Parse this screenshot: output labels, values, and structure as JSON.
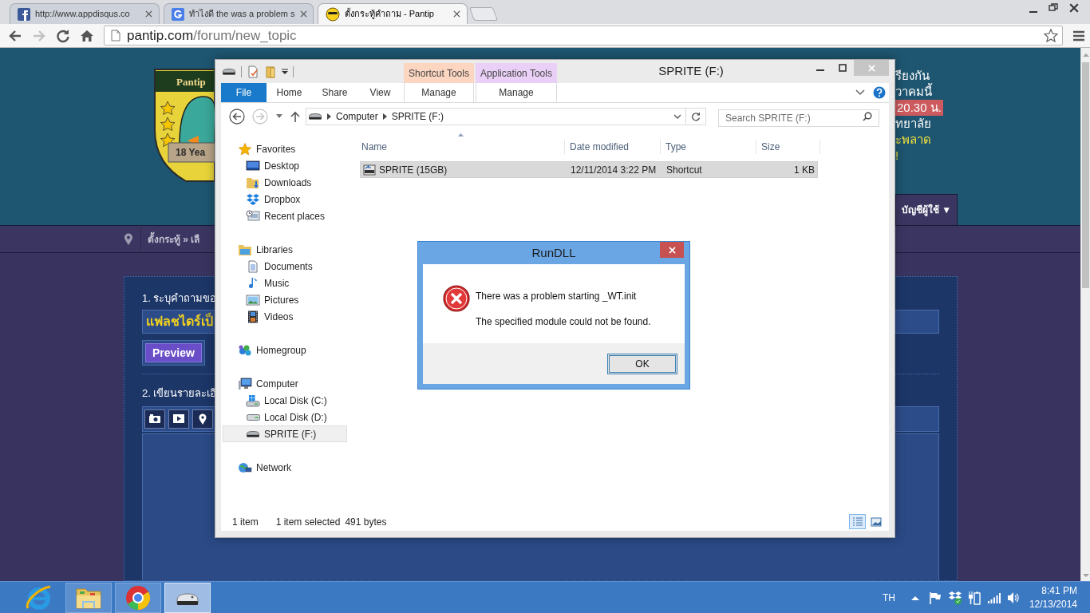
{
  "browser": {
    "tabs": [
      {
        "kind": "facebook",
        "title": "http://www.appdisqus.co",
        "selected": false
      },
      {
        "kind": "google",
        "title": "ทำไงดี the was a problem s",
        "selected": false
      },
      {
        "kind": "pantip",
        "title": "ตั้งกระทู้คำถาม - Pantip",
        "selected": true
      }
    ],
    "address": {
      "host": "pantip.com",
      "path": "/forum/new_topic"
    }
  },
  "page": {
    "logo": {
      "title": "Pantip",
      "ribbon": "18 Yea"
    },
    "announcement": [
      {
        "kind": "text",
        "text": "รียงกัน"
      },
      {
        "kind": "text",
        "text": "วาคมนี้"
      },
      {
        "kind": "tag",
        "text": "20.30 น."
      },
      {
        "kind": "text",
        "text": "ทยาลัย"
      },
      {
        "kind": "accent",
        "text": "ะพลาด"
      },
      {
        "kind": "accent",
        "text": "!"
      }
    ],
    "account_menu": "บัญชีผู้ใช้ ▼",
    "breadcrumb": "ตั้งกระทู้ » เลื",
    "form": {
      "step_1": "1. ระบุคำถามขอ",
      "title_value": "แฟลชไดร์เป็",
      "preview_button": "Preview",
      "step_2": "2. เขียนรายละเอี"
    }
  },
  "explorer": {
    "title": "SPRITE (F:)",
    "context_groups": [
      {
        "label": "Shortcut Tools",
        "color": "#fcd6c0",
        "tab": "Manage"
      },
      {
        "label": "Application Tools",
        "color": "#ead0f6",
        "tab": "Manage"
      }
    ],
    "tabs": [
      {
        "kind": "file",
        "label": "File"
      },
      {
        "kind": "tab",
        "label": "Home"
      },
      {
        "kind": "tab",
        "label": "Share"
      },
      {
        "kind": "tab",
        "label": "View"
      }
    ],
    "breadcrumb": [
      "Computer",
      "SPRITE (F:)"
    ],
    "search_placeholder": "Search SPRITE (F:)",
    "nav": [
      {
        "kind": "favorites",
        "label": "Favorites",
        "selected": false,
        "children": [
          {
            "kind": "desktop",
            "label": "Desktop",
            "selected": false
          },
          {
            "kind": "downloads",
            "label": "Downloads",
            "selected": false
          },
          {
            "kind": "dropbox",
            "label": "Dropbox",
            "selected": false
          },
          {
            "kind": "recent",
            "label": "Recent places",
            "selected": false
          }
        ]
      },
      {
        "kind": "libraries",
        "label": "Libraries",
        "selected": false,
        "children": [
          {
            "kind": "documents",
            "label": "Documents",
            "selected": false
          },
          {
            "kind": "music",
            "label": "Music",
            "selected": false
          },
          {
            "kind": "pictures",
            "label": "Pictures",
            "selected": false
          },
          {
            "kind": "videos",
            "label": "Videos",
            "selected": false
          }
        ]
      },
      {
        "kind": "homegroup",
        "label": "Homegroup",
        "selected": false
      },
      {
        "kind": "computer",
        "label": "Computer",
        "selected": false,
        "children": [
          {
            "kind": "system_disk",
            "label": "Local Disk (C:)",
            "selected": false
          },
          {
            "kind": "disk",
            "label": "Local Disk (D:)",
            "selected": false
          },
          {
            "kind": "removable",
            "label": "SPRITE (F:)",
            "selected": true
          }
        ]
      },
      {
        "kind": "network",
        "label": "Network",
        "selected": false
      }
    ],
    "columns": [
      {
        "label": "Name",
        "sorted": true
      },
      {
        "label": "Date modified",
        "sorted": false
      },
      {
        "label": "Type",
        "sorted": false
      },
      {
        "label": "Size",
        "sorted": false
      }
    ],
    "rows": [
      {
        "cells": [
          "SPRITE (15GB)",
          "12/11/2014 3:22 PM",
          "Shortcut",
          "1 KB"
        ],
        "selected": true
      }
    ],
    "status": {
      "count": "1 item",
      "selection": "1 item selected",
      "size": "491 bytes"
    },
    "views": [
      {
        "kind": "details",
        "selected": true
      },
      {
        "kind": "large_icons",
        "selected": false
      }
    ]
  },
  "dialog": {
    "title": "RunDLL",
    "message": "There was a problem starting _WT.init",
    "detail": "The specified module could not be found.",
    "button": "OK"
  },
  "taskbar": {
    "apps": [
      {
        "kind": "ie",
        "running": false,
        "selected": false
      },
      {
        "kind": "explorer",
        "running": true,
        "selected": false
      },
      {
        "kind": "chrome",
        "running": true,
        "selected": false
      },
      {
        "kind": "drive",
        "running": true,
        "selected": true
      }
    ],
    "language": "TH",
    "time": "8:41 PM",
    "date": "12/13/2014"
  }
}
